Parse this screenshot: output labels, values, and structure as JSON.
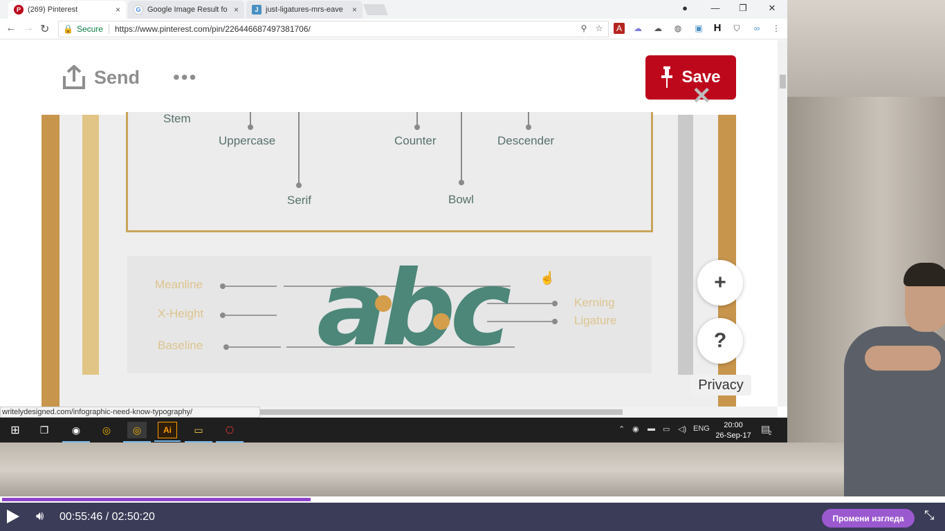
{
  "browser": {
    "tabs": [
      {
        "title": "(269) Pinterest",
        "icon": "pinterest-icon",
        "active": true
      },
      {
        "title": "Google Image Result fo",
        "icon": "google-icon",
        "active": false
      },
      {
        "title": "just-ligatures-mrs-eave",
        "icon": "page-icon",
        "active": false
      }
    ],
    "close_glyph": "×",
    "secure_label": "Secure",
    "url": "https://www.pinterest.com/pin/226446687497381706/",
    "status_url": "writelydesigned.com/infographic-need-know-typography/"
  },
  "pin": {
    "send_label": "Send",
    "more_label": "•••",
    "save_label": "Save",
    "close_label": "✕",
    "add_label": "+",
    "help_label": "?",
    "privacy_label": "Privacy"
  },
  "infographic": {
    "anatomy_terms": {
      "stem": "Stem",
      "uppercase": "Uppercase",
      "counter": "Counter",
      "descender": "Descender",
      "serif": "Serif",
      "bowl": "Bowl"
    },
    "guides": {
      "meanline": "Meanline",
      "xheight": "X-Height",
      "baseline": "Baseline",
      "kerning": "Kerning",
      "ligature": "Ligature"
    },
    "sample_text": "abc",
    "colors": {
      "teal": "#4c8779",
      "gold": "#d59e4a",
      "stripe_dark": "#c8954c",
      "stripe_light": "#e1c586"
    }
  },
  "taskbar": {
    "language": "ENG",
    "time": "20:00",
    "date": "26-Sep-17",
    "notification_count": "2"
  },
  "player": {
    "time_display": "00:55:46 / 02:50:20",
    "progress": 0.328,
    "view_button": "Промени изгледа",
    "accent": "#8e44c9"
  }
}
